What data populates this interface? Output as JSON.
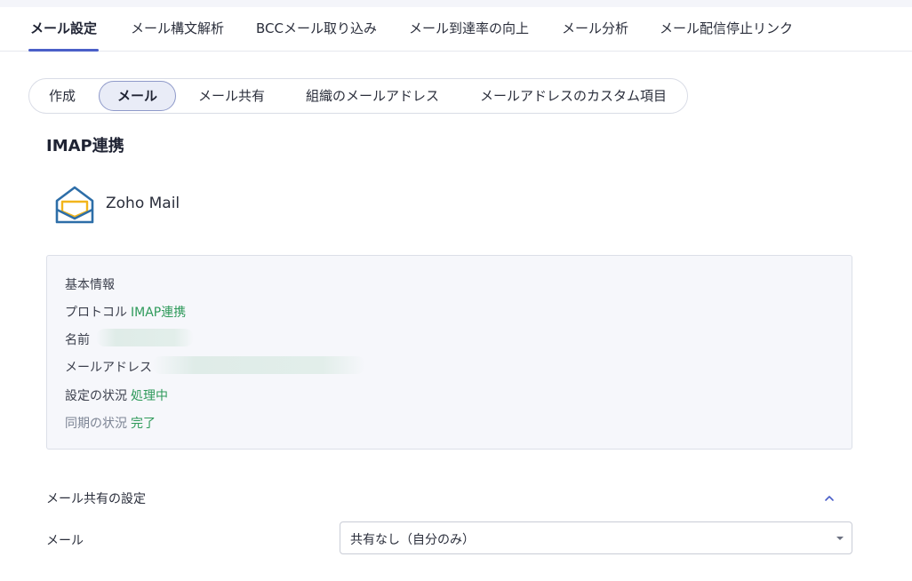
{
  "main_tabs": [
    {
      "label": "メール設定",
      "active": true
    },
    {
      "label": "メール構文解析"
    },
    {
      "label": "BCCメール取り込み"
    },
    {
      "label": "メール到達率の向上"
    },
    {
      "label": "メール分析"
    },
    {
      "label": "メール配信停止リンク"
    }
  ],
  "sub_tabs": [
    {
      "label": "作成"
    },
    {
      "label": "メール",
      "active": true
    },
    {
      "label": "メール共有"
    },
    {
      "label": "組織のメールアドレス"
    },
    {
      "label": "メールアドレスのカスタム項目"
    }
  ],
  "section_title": "IMAP連携",
  "provider": {
    "name": "Zoho Mail",
    "icon": "open-envelope-icon",
    "colors": {
      "outline": "#2d6ea8",
      "inner": "#f2b51c"
    }
  },
  "basic_info": {
    "heading": "基本情報",
    "protocol": {
      "label": "プロトコル",
      "value": "IMAP連携"
    },
    "name": {
      "label": "名前"
    },
    "email": {
      "label": "メールアドレス"
    },
    "setup_status": {
      "label": "設定の状況",
      "value": "処理中"
    },
    "sync_status": {
      "label": "同期の状況",
      "value": "完了"
    }
  },
  "mail_sharing": {
    "title": "メール共有の設定",
    "field_label": "メール",
    "selected_option": "共有なし（自分のみ）"
  },
  "colors": {
    "accent": "#4b5fc8",
    "status_green": "#2e9a5a",
    "info_box_bg": "#f6f7fb"
  }
}
